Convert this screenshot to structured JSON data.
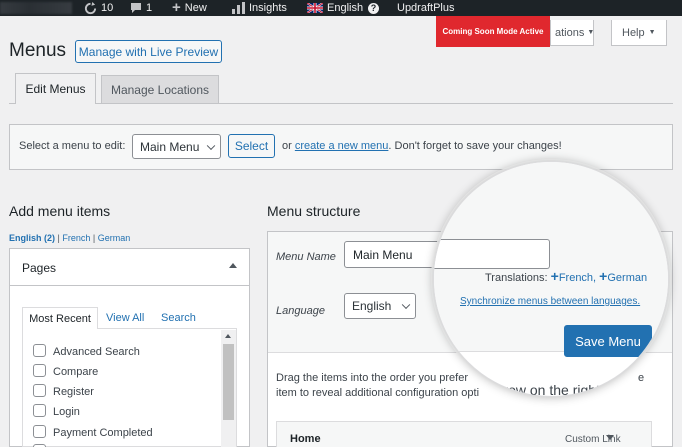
{
  "adminbar": {
    "updates_count": "10",
    "comments_count": "1",
    "new_label": "New",
    "insights_label": "Insights",
    "language_label": "English",
    "updraft_label": "UpdraftPlus",
    "coming_soon_label": "Coming Soon Mode Active"
  },
  "header": {
    "title": "Menus",
    "live_preview_button": "Manage with Live Preview",
    "screen_options_fragment": "ations",
    "help_label": "Help"
  },
  "tabs": [
    "Edit Menus",
    "Manage Locations"
  ],
  "select_bar": {
    "prompt": "Select a menu to edit:",
    "selected_menu": "Main Menu",
    "select_button": "Select",
    "or_text": "or",
    "create_link": "create a new menu",
    "suffix": ". Don't forget to save your changes!"
  },
  "add_items": {
    "title": "Add menu items",
    "languages": {
      "english": "English (2)",
      "sep1": " | ",
      "french": "French",
      "sep2": " | ",
      "german": "German"
    },
    "pages_title": "Pages",
    "page_tabs": [
      "Most Recent",
      "View All",
      "Search"
    ],
    "page_list": [
      "Advanced Search",
      "Compare",
      "Register",
      "Login",
      "Payment Completed"
    ]
  },
  "structure": {
    "title": "Menu structure",
    "menu_name_label": "Menu Name",
    "menu_name_value": "Main Menu",
    "language_label": "Language",
    "language_value": "English",
    "translations_label": "Translations:",
    "translation_french": "French,",
    "translation_german": "German",
    "sync_link": "Synchronize menus between languages.",
    "save_button": "Save Menu",
    "instructions_line1": "Drag the items into the order you prefer",
    "instructions_line1_tail": "e",
    "instructions_line2": "item to reveal additional configuration opti",
    "instructions_line2_tail": "arrow on the right of the",
    "item_title": "Home",
    "item_type": "Custom Link"
  },
  "colors": {
    "accent": "#2271b1",
    "adminbar": "#1d2327",
    "coming_soon": "#e0282e",
    "background": "#f0f0f1"
  }
}
